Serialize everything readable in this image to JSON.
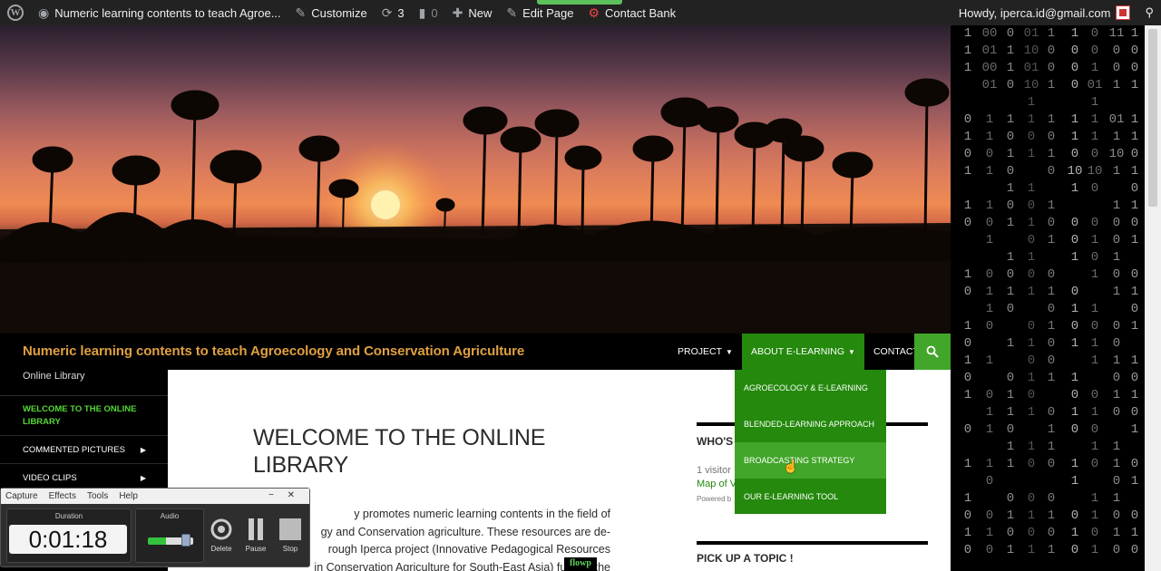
{
  "adminbar": {
    "site_name": "Numeric learning contents to teach Agroe...",
    "customize": "Customize",
    "updates_count": "3",
    "comments_count": "0",
    "new": "New",
    "edit_page": "Edit Page",
    "contact_bank": "Contact Bank",
    "howdy": "Howdy, iperca.id@gmail.com"
  },
  "header": {
    "site_title": "Numeric learning contents to teach Agroecology and Conservation Agriculture",
    "site_description": "Online Library"
  },
  "nav": {
    "items": [
      {
        "label": "PROJECT"
      },
      {
        "label": "ABOUT E-LEARNING"
      },
      {
        "label": "CONTACT US"
      }
    ],
    "dropdown": [
      {
        "label": "AGROECOLOGY & E-LEARNING"
      },
      {
        "label": "BLENDED-LEARNING APPROACH"
      },
      {
        "label": "BROADCASTING STRATEGY"
      },
      {
        "label": "OUR E-LEARNING TOOL"
      }
    ]
  },
  "sidebar": {
    "items": [
      {
        "label": "WELCOME TO THE ONLINE LIBRARY"
      },
      {
        "label": "COMMENTED PICTURES"
      },
      {
        "label": "VIDEO CLIPS"
      }
    ]
  },
  "main": {
    "title": "WELCOME TO THE ONLINE LIBRARY",
    "line1": "y promotes numeric learning contents in the field of",
    "line2": "gy and Conservation agriculture. These resources are de-",
    "line3": "rough Iperca project (Innovative Pedagogical Resources",
    "line4": "in Conservation Agriculture for South-East Asia) funded  the"
  },
  "widgets": {
    "whos_title": "WHO'S",
    "visitors": "1 visitor",
    "map_link": "Map of V",
    "powered": "Powered b",
    "topic_title": "PICK UP A TOPIC !"
  },
  "recorder": {
    "menu": [
      "Capture",
      "Effects",
      "Tools",
      "Help"
    ],
    "duration_label": "Duration",
    "duration": "0:01:18",
    "audio_label": "Audio",
    "audio_level": 0.4,
    "delete": "Delete",
    "pause": "Pause",
    "stop": "Stop"
  },
  "overlay": {
    "flowp": "flowp"
  },
  "matrix": {
    "columns": [
      "1\n1\n1\n\n\n0\n1\n0\n1\n\n1\n0\n\n\n1\n0\n\n1\n0\n1\n0\n1\n\n0\n\n1\n\n1\n0\n1\n0",
      "00\n01\n00\n01\n\n1\n1\n0\n1\n\n1\n0\n1\n\n0\n1\n1\n0\n\n1\n\n0\n1\n1\n\n1\n0\n\n0\n1\n0",
      "0\n1\n1\n0\n\n1\n0\n1\n0\n1\n0\n1\n\n1\n0\n1\n0\n\n1\n\n0\n1\n1\n0\n1\n1\n\n0\n1\n0\n1",
      "01\n10\n01\n10\n1\n1\n0\n1\n\n1\n0\n1\n0\n1\n0\n1\n\n0\n1\n0\n1\n0\n1\n\n1\n0\n\n0\n1\n0\n1",
      "1\n0\n0\n1\n\n1\n0\n1\n0\n\n1\n0\n1\n\n0\n1\n0\n1\n0\n0\n1\n\n0\n1\n1\n0\n\n0\n1\n0\n1",
      "1\n0\n0\n0\n\n1\n1\n0\n10\n1\n\n0\n0\n1\n\n0\n1\n0\n1\n\n1\n0\n1\n0\n\n1\n1\n\n0\n1\n0",
      "0\n0\n1\n01\n1\n1\n1\n0\n10\n0\n\n0\n1\n0\n1\n\n1\n0\n1\n1\n\n0\n1\n0\n1\n0\n\n1\n1\n0\n1",
      "11\n0\n0\n1\n\n01\n1\n10\n1\n\n1\n0\n0\n1\n0\n1\n\n0\n0\n1\n0\n1\n0\n\n1\n1\n0\n1\n0\n1\n0",
      "1\n0\n0\n1\n\n1\n1\n0\n1\n0\n1\n0\n1\n\n0\n1\n0\n1\n\n1\n0\n1\n0\n1\n\n0\n1\n\n0\n1\n0"
    ]
  }
}
